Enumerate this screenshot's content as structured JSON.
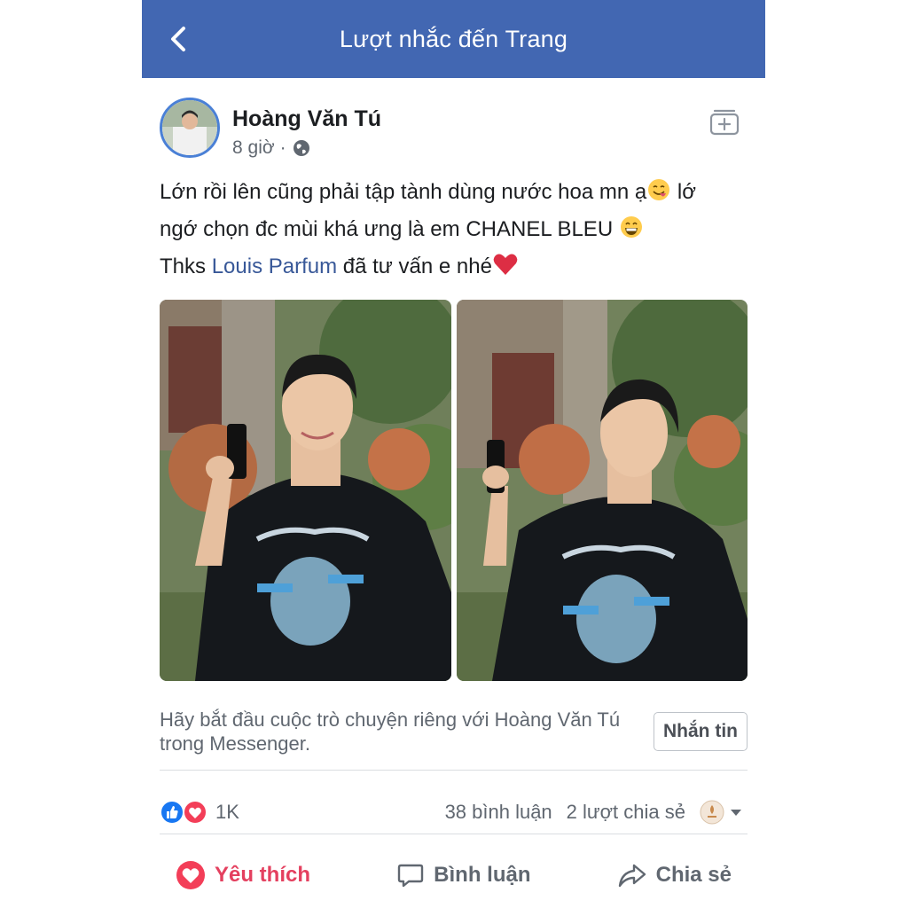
{
  "header": {
    "title": "Lượt nhắc đến Trang"
  },
  "post": {
    "author": "Hoàng Văn Tú",
    "time": "8 giờ",
    "dot": "·",
    "text_line1": "Lớn rồi lên cũng phải tập tành dùng nước hoa mn ạ",
    "text_line1_end": " lớ",
    "text_line2": "ngớ chọn đc mùi khá ưng là em CHANEL BLEU ",
    "text_line3_start": "Thks ",
    "text_line3_link": "Louis Parfum",
    "text_line3_end": " đã tư vấn e nhé"
  },
  "messenger": {
    "prompt": "Hãy bắt đầu cuộc trò chuyện riêng với Hoàng Văn Tú trong Messenger.",
    "button_label": "Nhắn tin"
  },
  "stats": {
    "reaction_count": "1K",
    "comments": "38 bình luận",
    "shares": "2 lượt chia sẻ"
  },
  "actions": {
    "like": "Yêu thích",
    "comment": "Bình luận",
    "share": "Chia sẻ"
  },
  "colors": {
    "header_blue": "#4267b2",
    "link_blue": "#385898",
    "love_red": "#e4405f",
    "like_blue": "#1877f2"
  }
}
